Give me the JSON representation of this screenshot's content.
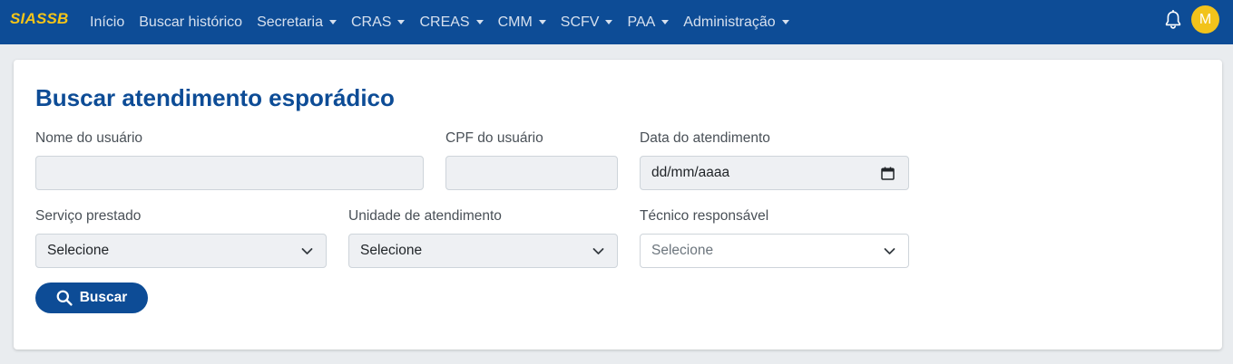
{
  "app": {
    "brand": "SIASSB",
    "brand_color": "#f5c518",
    "navbar_color": "#0d4c96"
  },
  "nav": {
    "items": [
      {
        "label": "Início",
        "dropdown": false
      },
      {
        "label": "Buscar histórico",
        "dropdown": false
      },
      {
        "label": "Secretaria",
        "dropdown": true
      },
      {
        "label": "CRAS",
        "dropdown": true
      },
      {
        "label": "CREAS",
        "dropdown": true
      },
      {
        "label": "CMM",
        "dropdown": true
      },
      {
        "label": "SCFV",
        "dropdown": true
      },
      {
        "label": "PAA",
        "dropdown": true
      },
      {
        "label": "Administração",
        "dropdown": true
      }
    ],
    "notification_icon": "bell-icon",
    "avatar_initial": "M",
    "avatar_color": "#f2c31b"
  },
  "page": {
    "title": "Buscar atendimento esporádico"
  },
  "form": {
    "nome_label": "Nome do usuário",
    "nome_value": "",
    "cpf_label": "CPF do usuário",
    "cpf_value": "",
    "data_label": "Data do atendimento",
    "data_value": "dd/mm/aaaa",
    "servico_label": "Serviço prestado",
    "servico_value": "Selecione",
    "unidade_label": "Unidade de atendimento",
    "unidade_value": "Selecione",
    "tecnico_label": "Técnico responsável",
    "tecnico_value": "Selecione",
    "search_button": "Buscar",
    "search_icon": "search-icon"
  }
}
